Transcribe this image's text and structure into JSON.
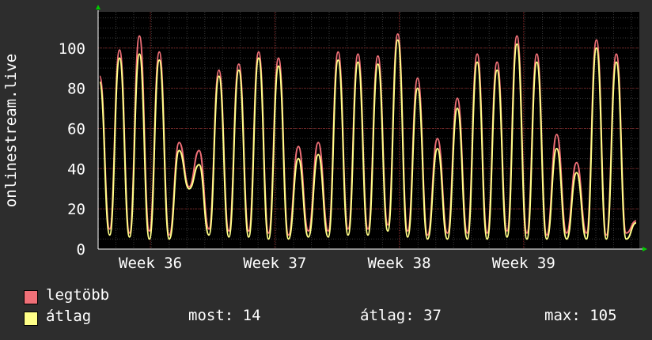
{
  "chart_data": {
    "type": "line",
    "ylabel": "onlinestream.live",
    "ylim": [
      0,
      118
    ],
    "yticks": [
      0,
      20,
      40,
      60,
      80,
      100
    ],
    "xticks": [
      "Week 36",
      "Week 37",
      "Week 38",
      "Week 39"
    ],
    "grid": true,
    "colors": {
      "background": "#2d2d2d",
      "plot": "#000000",
      "minor_grid": "#3a3a3a",
      "major_grid": "#7a2020",
      "axis_arrow": "#00cc00"
    },
    "series": [
      {
        "name": "legtöbb",
        "color": "#f07078",
        "values": [
          86,
          10,
          99,
          8,
          106,
          9,
          98,
          7,
          53,
          31,
          49,
          10,
          89,
          9,
          92,
          9,
          98,
          8,
          95,
          7,
          51,
          9,
          53,
          9,
          98,
          10,
          97,
          10,
          96,
          12,
          107,
          9,
          85,
          7,
          55,
          8,
          75,
          8,
          97,
          8,
          93,
          9,
          106,
          8,
          97,
          7,
          57,
          8,
          43,
          8,
          104,
          7,
          97,
          8,
          14
        ]
      },
      {
        "name": "átlag",
        "color": "#ffff88",
        "values": [
          83,
          7,
          95,
          6,
          97,
          5,
          94,
          5,
          49,
          30,
          42,
          7,
          86,
          6,
          89,
          6,
          95,
          5,
          91,
          5,
          45,
          6,
          47,
          6,
          94,
          7,
          93,
          7,
          92,
          9,
          104,
          6,
          80,
          5,
          50,
          5,
          70,
          5,
          93,
          5,
          89,
          6,
          102,
          5,
          93,
          5,
          50,
          5,
          38,
          5,
          100,
          5,
          93,
          5,
          13
        ]
      }
    ]
  },
  "legend": {
    "max_label": "legtöbb",
    "avg_label": "átlag",
    "max_color": "#f07078",
    "avg_color": "#ffff88"
  },
  "stats": {
    "now": "most: 14",
    "avg": "átlag: 37",
    "max": "max: 105"
  }
}
